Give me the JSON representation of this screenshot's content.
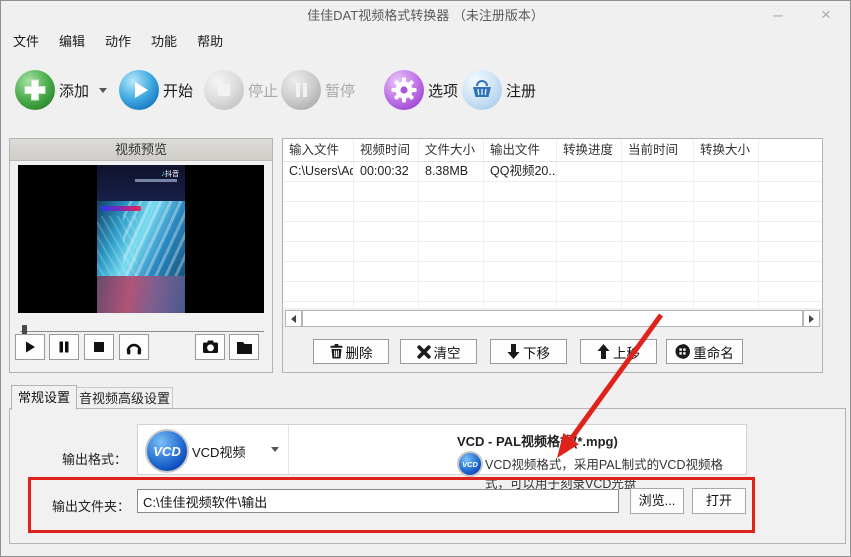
{
  "window": {
    "title": "佳佳DAT视频格式转换器 （未注册版本）",
    "minimize": "–",
    "close": "×"
  },
  "menu_items": [
    "文件",
    "编辑",
    "动作",
    "功能",
    "帮助"
  ],
  "toolbar": [
    {
      "label": "添加",
      "icon": "add-plus",
      "enabled": true,
      "has_dropdown": true
    },
    {
      "label": "开始",
      "icon": "play",
      "enabled": true
    },
    {
      "label": "停止",
      "icon": "stop",
      "enabled": false
    },
    {
      "label": "暂停",
      "icon": "pause",
      "enabled": false
    },
    {
      "label": "选项",
      "icon": "gear",
      "enabled": true
    },
    {
      "label": "注册",
      "icon": "shopping-basket",
      "enabled": true
    }
  ],
  "preview": {
    "title": "视频预览",
    "watermark": "抖音"
  },
  "file_table": {
    "columns": [
      "输入文件",
      "视频时间",
      "文件大小",
      "输出文件",
      "转换进度",
      "当前时间",
      "转换大小"
    ],
    "rows": [
      [
        "C:\\Users\\Ad...",
        "00:00:32",
        "8.38MB",
        "QQ视频20...",
        "",
        "",
        ""
      ]
    ]
  },
  "list_buttons": [
    {
      "label": "删除",
      "icon": "trash"
    },
    {
      "label": "清空",
      "icon": "clear-x"
    },
    {
      "label": "下移",
      "icon": "arrow-down"
    },
    {
      "label": "上移",
      "icon": "arrow-up"
    },
    {
      "label": "重命名",
      "icon": "rename-circle"
    }
  ],
  "tabs": [
    {
      "label": "常规设置",
      "active": true
    },
    {
      "label": "音视频高级设置",
      "active": false
    }
  ],
  "format_section": {
    "label": "输出格式：",
    "icon_text": "VCD",
    "selected_name": "VCD视频",
    "detail_title": "VCD - PAL视频格式(*.mpg)",
    "detail_desc": "VCD视频格式，采用PAL制式的VCD视频格式，可以用于刻录VCD光盘"
  },
  "folder_section": {
    "label": "输出文件夹：",
    "path": "C:\\佳佳视频软件\\输出",
    "browse": "浏览...",
    "open": "打开"
  },
  "colors": {
    "annotation": "#e0231a",
    "vcd_blue": "#0a46b8",
    "add_green": "#2e8b2e",
    "start_blue": "#1576c0",
    "options_purple": "#9a40cc",
    "register_blue": "#a4c9e9"
  }
}
